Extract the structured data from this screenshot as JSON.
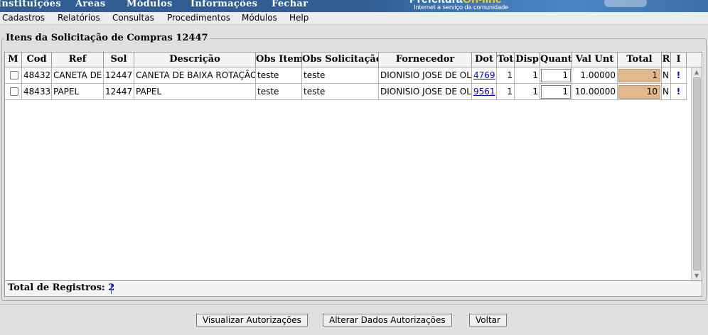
{
  "top_nav": [
    "Instituições",
    "Áreas",
    "Módulos",
    "Informações",
    "Fechar"
  ],
  "brand": {
    "logo_main": "Prefeitura",
    "logo_accent": "On-line",
    "tagline": "Internet a serviço da comunidade"
  },
  "menu": [
    "Cadastros",
    "Relatórios",
    "Consultas",
    "Procedimentos",
    "Módulos",
    "Help"
  ],
  "section_title": "Itens da Solicitação de Compras 12447",
  "grid": {
    "columns": [
      "M",
      "Cod",
      "Ref",
      "Sol",
      "Descrição",
      "Obs Item",
      "Obs Solicitação",
      "Fornecedor",
      "Dot",
      "Tot",
      "Disp",
      "Quant",
      "Val Unt",
      "Total",
      "R",
      "I"
    ],
    "rows": [
      {
        "cod": "48432",
        "ref": "CANETA DE",
        "sol": "12447",
        "descricao": "CANETA DE BAIXA ROTAÇÃO",
        "obs_item": "teste",
        "obs_solicitacao": "teste",
        "fornecedor": "DIONISIO JOSE DE OLI",
        "dot": "4769",
        "tot": "1",
        "disp": "1",
        "quant": "1",
        "val_unt": "1.00000",
        "total": "1",
        "r": "N",
        "i": "!"
      },
      {
        "cod": "48433",
        "ref": "PAPEL",
        "sol": "12447",
        "descricao": "PAPEL",
        "obs_item": "teste",
        "obs_solicitacao": "teste",
        "fornecedor": "DIONISIO JOSE DE OLI",
        "dot": "9561",
        "tot": "1",
        "disp": "1",
        "quant": "1",
        "val_unt": "10.00000",
        "total": "10",
        "r": "N",
        "i": "!"
      }
    ]
  },
  "footer": {
    "records_label": "Total de Registros:",
    "records_count": "2"
  },
  "buttons": {
    "visualizar": "Visualizar Autorizações",
    "alterar": "Alterar Dados Autorizações",
    "voltar": "Voltar"
  },
  "colors": {
    "banner": "#2f5d94",
    "total_cell": "#e2b88c",
    "link": "#0000cc"
  }
}
